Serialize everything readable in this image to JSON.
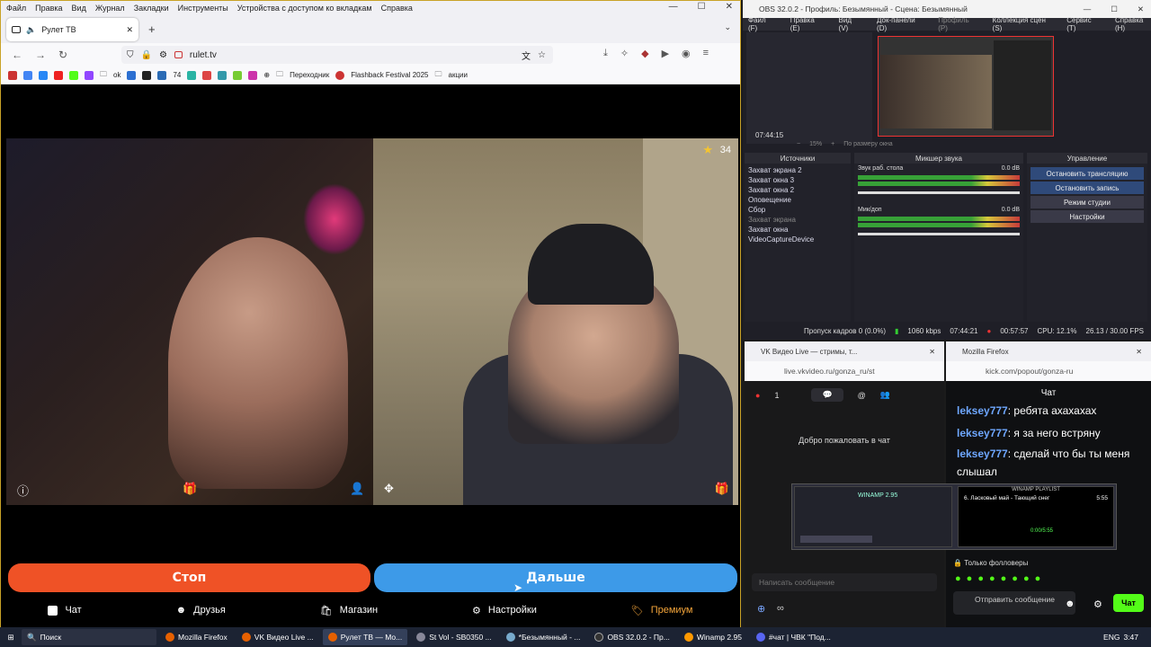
{
  "firefox": {
    "menu": [
      "Файл",
      "Правка",
      "Вид",
      "Журнал",
      "Закладки",
      "Инструменты",
      "Устройства с доступом ко вкладкам",
      "Справка"
    ],
    "tab_title": "Рулет ТВ",
    "url": "rulet.tv",
    "bookmarks": [
      "ok",
      "74",
      "Переходник",
      "Flashback Festival 2025",
      "акции"
    ],
    "win_min": "—",
    "win_max": "☐",
    "win_close": "✕"
  },
  "site": {
    "viewer_count": "34",
    "stop_label": "Стоп",
    "next_label": "Дальше",
    "nav": [
      {
        "label": "Чат",
        "icon": "chat-icon"
      },
      {
        "label": "Друзья",
        "icon": "friends-icon"
      },
      {
        "label": "Магазин",
        "icon": "shop-icon"
      },
      {
        "label": "Настройки",
        "icon": "gear-icon"
      },
      {
        "label": "Премиум",
        "icon": "premium-icon"
      }
    ],
    "colors": {
      "stop": "#ef5226",
      "next": "#3d9ae8",
      "premium": "#f4a53a"
    }
  },
  "obs": {
    "title": "OBS 32.0.2 - Профиль: Безымянный - Сцена: Безымянный",
    "menu": [
      "Файл (F)",
      "Правка (E)",
      "Вид (V)",
      "Док-панели (D)",
      "Профиль (P)",
      "Коллекция сцен (S)",
      "Сервис (T)",
      "Справка (H)"
    ],
    "zoom": "15%",
    "zoom_mode": "По размеру окна",
    "timer": "07:44:15",
    "docks": {
      "sources": "Источники",
      "mixer": "Микшер звука",
      "controls": "Управление"
    },
    "sources": [
      "Захват экрана 2",
      "Захват окна 3",
      "Захват окна 2",
      "Оповещение",
      "Сбор",
      "Захват экрана",
      "Захват окна",
      "VideoCaptureDevice"
    ],
    "mixer": [
      {
        "name": "Звук раб. стола",
        "db": "0.0 dB"
      },
      {
        "name": "Мик/доп",
        "db": "0.0 dB"
      }
    ],
    "controls": [
      "Остановить трансляцию",
      "Остановить запись",
      "Режим студии",
      "Настройки"
    ],
    "status": {
      "dropped": "Пропуск кадров 0 (0.0%)",
      "bitrate": "1060 kbps",
      "stream_time": "07:44:21",
      "rec_time": "00:57:57",
      "cpu": "CPU: 12.1%",
      "fps": "26.13 / 30.00 FPS"
    }
  },
  "vk": {
    "title": "VK Видео Live — стримы, т...",
    "url": "live.vkvideo.ru/gonza_ru/st",
    "viewers": "1",
    "welcome": "Добро пожаловать в чат",
    "input_placeholder": "Написать сообщение"
  },
  "kick": {
    "title": "Mozilla Firefox",
    "url": "kick.com/popout/gonza-ru",
    "chat_header": "Чат",
    "messages": [
      {
        "user": "leksey777",
        "text": "ребята ахахахах"
      },
      {
        "user": "leksey777",
        "text": "я за него встряну"
      },
      {
        "user": "leksey777",
        "text": "сделай что бы ты меня слышал"
      }
    ],
    "followers_only": "Только фолловеры",
    "send_placeholder": "Отправить сообщение",
    "chat_button": "Чат"
  },
  "winamp": {
    "title": "WINAMP 2.95",
    "playlist_title": "WINAMP PLAYLIST",
    "track": "6. Ласковый май - Тающий снег",
    "track_time": "5:55",
    "elapsed": "0:00/5:55"
  },
  "taskbar": {
    "search": "Поиск",
    "items": [
      "Mozilla Firefox",
      "VK Видео Live ...",
      "Рулет ТВ — Мо...",
      "St Vol - SB0350 ...",
      "*Безымянный - ...",
      "OBS 32.0.2 - Пр...",
      "Winamp 2.95",
      "#чат | ЧВК \"Под..."
    ],
    "lang": "ENG",
    "time": "3:47"
  }
}
